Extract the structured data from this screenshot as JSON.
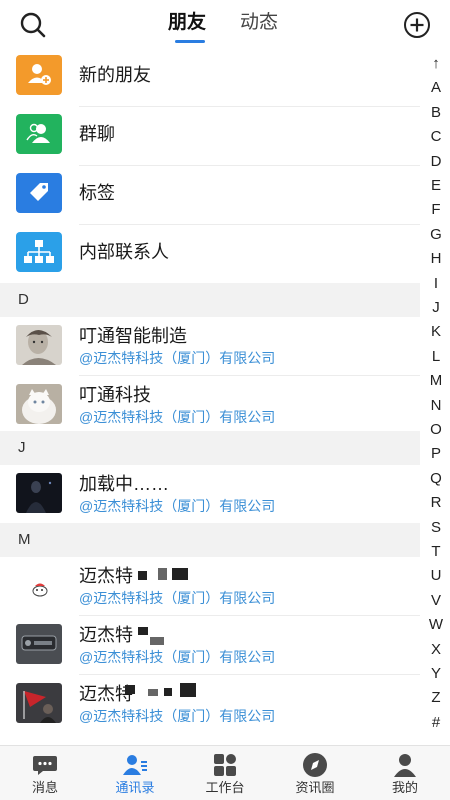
{
  "header": {
    "tabs": [
      {
        "label": "朋友",
        "active": true
      },
      {
        "label": "动态",
        "active": false
      }
    ],
    "icons": {
      "left": "search-icon",
      "right": "add-circle-icon"
    },
    "accent_color": "#2a7de1"
  },
  "features": [
    {
      "label": "新的朋友",
      "icon": "new-friend-icon",
      "color": "#f39a2b"
    },
    {
      "label": "群聊",
      "icon": "group-chat-icon",
      "color": "#22b35e"
    },
    {
      "label": "标签",
      "icon": "tag-icon",
      "color": "#2a7de1"
    },
    {
      "label": "内部联系人",
      "icon": "org-chart-icon",
      "color": "#2ba0e8"
    }
  ],
  "sections": [
    {
      "letter": "D",
      "contacts": [
        {
          "name": "叮通智能制造",
          "company": "@迈杰特科技（厦门）有限公司",
          "avatar": "sketch-portrait"
        },
        {
          "name": "叮通科技",
          "company": "@迈杰特科技（厦门）有限公司",
          "avatar": "white-cat"
        }
      ]
    },
    {
      "letter": "J",
      "contacts": [
        {
          "name": "加载中……",
          "company": "@迈杰特科技（厦门）有限公司",
          "avatar": "dark-figure"
        }
      ]
    },
    {
      "letter": "M",
      "contacts": [
        {
          "name": "迈杰特",
          "company": "@迈杰特科技（厦门）有限公司",
          "avatar": "small-cartoon"
        },
        {
          "name": "迈杰特",
          "company": "@迈杰特科技（厦门）有限公司",
          "avatar": "dark-logo"
        },
        {
          "name": "迈杰特",
          "company": "@迈杰特科技（厦门）有限公司",
          "avatar": "red-flag-photo"
        }
      ]
    }
  ],
  "index_letters": [
    "↑",
    "A",
    "B",
    "C",
    "D",
    "E",
    "F",
    "G",
    "H",
    "I",
    "J",
    "K",
    "L",
    "M",
    "N",
    "O",
    "P",
    "Q",
    "R",
    "S",
    "T",
    "U",
    "V",
    "W",
    "X",
    "Y",
    "Z",
    "#"
  ],
  "bottom_nav": [
    {
      "label": "消息",
      "icon": "message-icon",
      "active": false
    },
    {
      "label": "通讯录",
      "icon": "contacts-icon",
      "active": true
    },
    {
      "label": "工作台",
      "icon": "workbench-icon",
      "active": false
    },
    {
      "label": "资讯圈",
      "icon": "compass-icon",
      "active": false
    },
    {
      "label": "我的",
      "icon": "profile-icon",
      "active": false
    }
  ]
}
